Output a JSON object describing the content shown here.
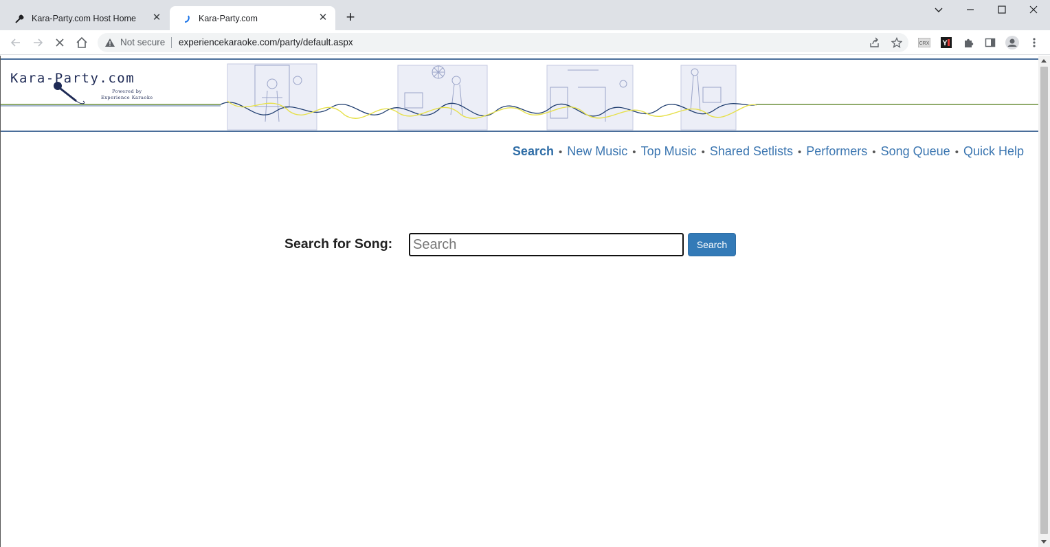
{
  "browser": {
    "tabs": [
      {
        "title": "Kara-Party.com Host Home",
        "icon": "microphone-icon",
        "active": false
      },
      {
        "title": "Kara-Party.com",
        "icon": "loading-spinner-icon",
        "active": true
      }
    ],
    "address": {
      "security_label": "Not secure",
      "url": "experiencekaraoke.com/party/default.aspx"
    },
    "extensions": [
      {
        "name": "crx-icon",
        "label": "CRX"
      },
      {
        "name": "yb-extension-icon",
        "label": "Y"
      }
    ]
  },
  "banner": {
    "logo_text": "Kara-Party.com",
    "logo_sub_line1": "Powered by",
    "logo_sub_line2": "Experience Karaoke"
  },
  "nav": {
    "items": [
      "Search",
      "New Music",
      "Top Music",
      "Shared Setlists",
      "Performers",
      "Song Queue",
      "Quick Help"
    ],
    "separator": "•",
    "active": "Search"
  },
  "search": {
    "label": "Search for Song:",
    "placeholder": "Search",
    "button_label": "Search"
  },
  "colors": {
    "link": "#3a75b0",
    "button": "#337ab7",
    "banner_rule": "#4a6e9a",
    "wave_green": "#6b8f3a",
    "wave_yellow": "#e6e04a"
  }
}
